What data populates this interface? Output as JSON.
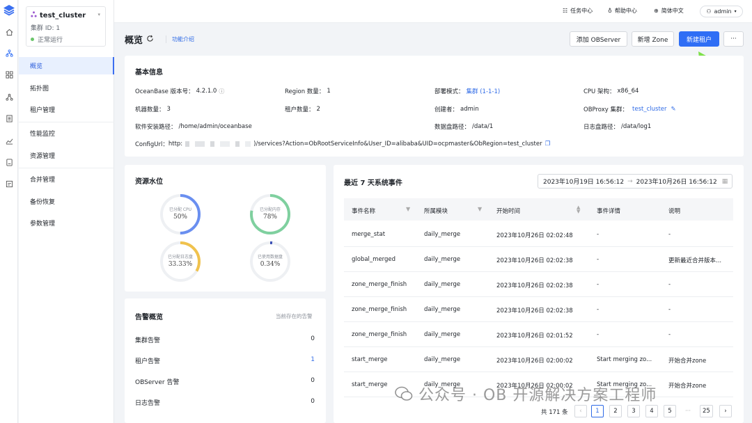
{
  "cluster": {
    "name": "test_cluster",
    "id_label": "集群 ID: 1",
    "status": "正常运行"
  },
  "nav": [
    "概览",
    "拓扑图",
    "租户管理",
    "性能监控",
    "资源管理",
    "合并管理",
    "备份恢复",
    "参数管理"
  ],
  "topbar": {
    "tasks": "任务中心",
    "help": "帮助中心",
    "lang": "简体中文",
    "user": "admin"
  },
  "header": {
    "title": "概览",
    "func_intro": "功能介绍",
    "btn_add_observer": "添加 OBServer",
    "btn_add_zone": "新增 Zone",
    "btn_new_tenant": "新建租户",
    "btn_more": "···"
  },
  "basic": {
    "title": "基本信息",
    "version_label": "OceanBase 版本号：",
    "version": "4.2.1.0",
    "region_label": "Region 数量：",
    "region": "1",
    "deploy_label": "部署模式：",
    "deploy": "集群 (1-1-1)",
    "cpu_label": "CPU 架构：",
    "cpu": "x86_64",
    "machines_label": "机器数量：",
    "machines": "3",
    "tenants_label": "租户数量：",
    "tenants": "2",
    "creator_label": "创建者：",
    "creator": "admin",
    "obproxy_label": "OBProxy 集群：",
    "obproxy": "test_cluster",
    "install_label": "软件安装路径：",
    "install": "/home/admin/oceanbase",
    "datadisk_label": "数据盘路径：",
    "datadisk": "/data/1",
    "logdisk_label": "日志盘路径：",
    "logdisk": "/data/log1",
    "configurl_label": "ConfigUrl：",
    "configurl_prefix": "http:",
    "configurl_suffix": ")/services?Action=ObRootServiceInfo&User_ID=alibaba&UID=ocpmaster&ObRegion=test_cluster"
  },
  "resources": {
    "title": "资源水位",
    "gauges": [
      {
        "label": "已分配 CPU",
        "value": "50%",
        "fraction": 0.5,
        "color": "#6a8ff0"
      },
      {
        "label": "已分配内存",
        "value": "78%",
        "fraction": 0.78,
        "color": "#7fd09f"
      },
      {
        "label": "已分配日志盘",
        "value": "33.33%",
        "fraction": 0.3333,
        "color": "#f0c24d"
      },
      {
        "label": "已使用数据盘",
        "value": "0.34%",
        "fraction": 0.0034,
        "color": "#3a4fb5"
      }
    ]
  },
  "alerts": {
    "title": "告警概览",
    "subtitle": "当前存在的告警",
    "rows": [
      {
        "label": "集群告警",
        "count": "0"
      },
      {
        "label": "租户告警",
        "count": "1"
      },
      {
        "label": "OBServer 告警",
        "count": "0"
      },
      {
        "label": "日志告警",
        "count": "0"
      }
    ]
  },
  "events": {
    "title": "最近 7 天系统事件",
    "date_start": "2023年10月19日 16:56:12",
    "date_end": "2023年10月26日 16:56:12",
    "columns": [
      "事件名称",
      "所属模块",
      "开始时间",
      "事件详情",
      "说明"
    ],
    "rows": [
      [
        "merge_stat",
        "daily_merge",
        "2023年10月26日 02:02:48",
        "-",
        "-"
      ],
      [
        "global_merged",
        "daily_merge",
        "2023年10月26日 02:02:38",
        "-",
        "更新最近合并版本..."
      ],
      [
        "zone_merge_finish",
        "daily_merge",
        "2023年10月26日 02:02:38",
        "-",
        "-"
      ],
      [
        "zone_merge_finish",
        "daily_merge",
        "2023年10月26日 02:02:38",
        "-",
        "-"
      ],
      [
        "zone_merge_finish",
        "daily_merge",
        "2023年10月26日 02:01:52",
        "-",
        "-"
      ],
      [
        "start_merge",
        "daily_merge",
        "2023年10月26日 02:00:02",
        "Start merging zo...",
        "开始合并zone"
      ],
      [
        "start_merge",
        "daily_merge",
        "2023年10月26日 02:00:02",
        "Start merging zo...",
        "开始合并zone"
      ]
    ],
    "total": "共 171 条",
    "pages": [
      "1",
      "2",
      "3",
      "4",
      "5",
      "···",
      "25"
    ]
  },
  "watermark": "公众号 · OB 开源解决方案工程师",
  "colors": {
    "primary": "#2f6ef5",
    "active_bg": "#e8f0fe",
    "arrow": "#7ee04a"
  }
}
